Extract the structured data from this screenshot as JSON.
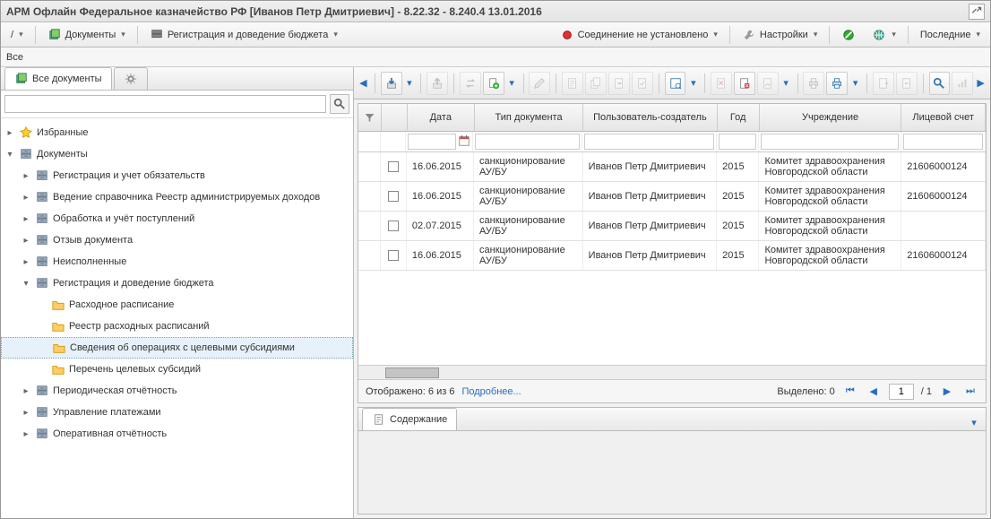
{
  "title": "АРМ Офлайн Федеральное казначейство РФ [Иванов Петр Дмитриевич] - 8.22.32 - 8.240.4 13.01.2016",
  "menu": {
    "documents": "Документы",
    "registration": "Регистрация и доведение бюджета",
    "connection": "Соединение не установлено",
    "settings": "Настройки",
    "recent": "Последние"
  },
  "breadcrumb": "Все",
  "sidebar": {
    "tab_all": "Все документы",
    "search_placeholder": "",
    "tree": [
      {
        "i": 0,
        "exp": "▸",
        "ico": "star",
        "label": "Избранные"
      },
      {
        "i": 0,
        "exp": "▾",
        "ico": "cab",
        "label": "Документы"
      },
      {
        "i": 1,
        "exp": "▸",
        "ico": "cab",
        "label": "Регистрация и учет обязательств"
      },
      {
        "i": 1,
        "exp": "▸",
        "ico": "cab",
        "label": "Ведение справочника Реестр администрируемых доходов"
      },
      {
        "i": 1,
        "exp": "▸",
        "ico": "cab",
        "label": "Обработка и учёт поступлений"
      },
      {
        "i": 1,
        "exp": "▸",
        "ico": "cab",
        "label": "Отзыв документа"
      },
      {
        "i": 1,
        "exp": "▸",
        "ico": "cab",
        "label": "Неисполненные"
      },
      {
        "i": 1,
        "exp": "▾",
        "ico": "cab",
        "label": "Регистрация и доведение бюджета"
      },
      {
        "i": 2,
        "exp": "",
        "ico": "fld",
        "label": "Расходное расписание"
      },
      {
        "i": 2,
        "exp": "",
        "ico": "fld",
        "label": "Реестр расходных расписаний"
      },
      {
        "i": 2,
        "exp": "",
        "ico": "fld",
        "label": "Сведения об операциях с целевыми субсидиями",
        "sel": true
      },
      {
        "i": 2,
        "exp": "",
        "ico": "fld",
        "label": "Перечень целевых субсидий"
      },
      {
        "i": 1,
        "exp": "▸",
        "ico": "cab",
        "label": "Периодическая отчётность"
      },
      {
        "i": 1,
        "exp": "▸",
        "ico": "cab",
        "label": "Управление платежами"
      },
      {
        "i": 1,
        "exp": "▸",
        "ico": "cab",
        "label": "Оперативная отчётность"
      }
    ]
  },
  "grid": {
    "headers": [
      "",
      "",
      "Дата",
      "Тип документа",
      "Пользователь-создатель",
      "Год",
      "Учреждение",
      "Лицевой счет"
    ],
    "rows": [
      {
        "date": "16.06.2015",
        "type": "санкционирование АУ/БУ",
        "user": "Иванов Петр Дмитриевич",
        "year": "2015",
        "org": "Комитет здравоохранения Новгородской области",
        "acc": "21606000124"
      },
      {
        "date": "16.06.2015",
        "type": "санкционирование АУ/БУ",
        "user": "Иванов Петр Дмитриевич",
        "year": "2015",
        "org": "Комитет здравоохранения Новгородской области",
        "acc": "21606000124"
      },
      {
        "date": "02.07.2015",
        "type": "санкционирование АУ/БУ",
        "user": "Иванов Петр Дмитриевич",
        "year": "2015",
        "org": "Комитет здравоохранения Новгородской области",
        "acc": ""
      },
      {
        "date": "16.06.2015",
        "type": "санкционирование АУ/БУ",
        "user": "Иванов Петр Дмитриевич",
        "year": "2015",
        "org": "Комитет здравоохранения Новгородской области",
        "acc": "21606000124"
      }
    ]
  },
  "status": {
    "shown": "Отображено: 6 из 6",
    "more": "Подробнее...",
    "selected": "Выделено:  0",
    "page": "1",
    "pages": "/ 1"
  },
  "detail": {
    "tab": "Содержание"
  }
}
